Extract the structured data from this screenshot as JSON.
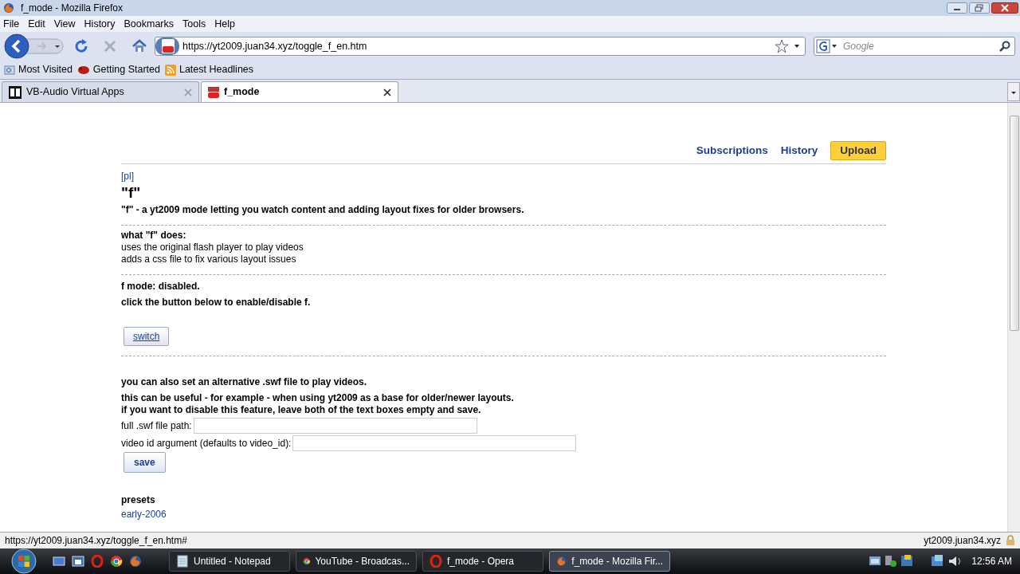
{
  "window": {
    "title": "f_mode - Mozilla Firefox"
  },
  "menu": [
    "File",
    "Edit",
    "View",
    "History",
    "Bookmarks",
    "Tools",
    "Help"
  ],
  "toolbar": {
    "url": "https://yt2009.juan34.xyz/toggle_f_en.htm",
    "search_placeholder": "Google"
  },
  "bookmarks": [
    {
      "label": "Most Visited",
      "kind": "folder"
    },
    {
      "label": "Getting Started",
      "kind": "start"
    },
    {
      "label": "Latest Headlines",
      "kind": "feed"
    }
  ],
  "tabs": [
    {
      "label": "VB-Audio Virtual Apps",
      "kind": "vb",
      "selected": false
    },
    {
      "label": "f_mode",
      "kind": "yt",
      "selected": true
    }
  ],
  "page": {
    "nav": [
      {
        "label": "Subscriptions",
        "kind": "link"
      },
      {
        "label": "History",
        "kind": "link"
      },
      {
        "label": "Upload",
        "kind": "button"
      }
    ],
    "lang_link": "[pl]",
    "heading": "\"f\"",
    "intro": "\"f\" - a yt2009 mode letting you watch content and adding layout fixes for older browsers.",
    "does_title": "what \"f\" does:",
    "does_items": [
      "uses the original flash player to play videos",
      "adds a css file to fix various layout issues"
    ],
    "status": "f mode: disabled.",
    "instruction": "click the button below to enable/disable f.",
    "switch_button": "switch",
    "swf_title": "you can also set an alternative .swf file to play videos.",
    "swf_notes": [
      "this can be useful - for example - when using yt2009 as a base for older/newer layouts.",
      "if you want to disable this feature, leave both of the text boxes empty and save."
    ],
    "fields": [
      {
        "label": "full .swf file path:"
      },
      {
        "label": "video id argument (defaults to video_id):"
      }
    ],
    "save_button": "save",
    "presets_title": "presets",
    "presets": [
      "early-2006"
    ]
  },
  "status_bar": {
    "url": "https://yt2009.juan34.xyz/toggle_f_en.htm#",
    "domain": "yt2009.juan34.xyz"
  },
  "taskbar": {
    "items": [
      {
        "label": "Untitled - Notepad",
        "kind": "notepad",
        "selected": false
      },
      {
        "label": "YouTube - Broadcas...",
        "kind": "chrome",
        "selected": false
      },
      {
        "label": "f_mode - Opera",
        "kind": "opera",
        "selected": false
      },
      {
        "label": "f_mode - Mozilla Fir...",
        "kind": "firefox",
        "selected": true
      }
    ],
    "clock": "12:56 AM"
  }
}
